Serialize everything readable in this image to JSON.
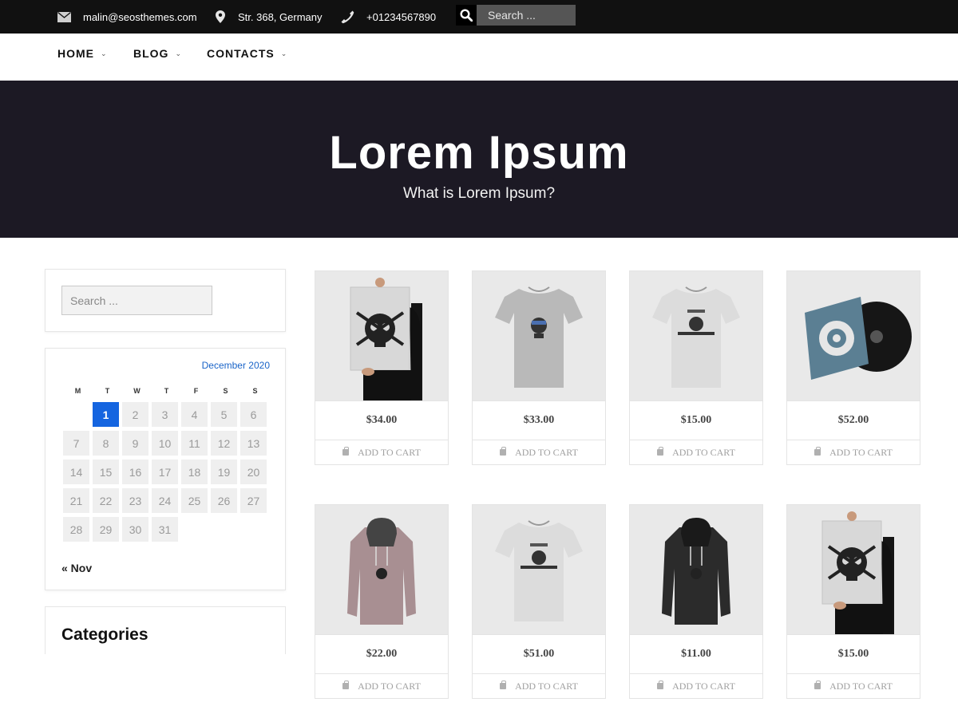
{
  "topbar": {
    "email": "malin@seosthemes.com",
    "address": "Str. 368, Germany",
    "phone": "+01234567890",
    "search_placeholder": "Search ..."
  },
  "nav": {
    "items": [
      {
        "label": "HOME"
      },
      {
        "label": "BLOG"
      },
      {
        "label": "CONTACTS"
      }
    ]
  },
  "hero": {
    "title": "Lorem Ipsum",
    "subtitle": "What is Lorem Ipsum?"
  },
  "sidebar": {
    "search_placeholder": "Search ...",
    "calendar": {
      "caption": "December 2020",
      "weekdays": [
        "M",
        "T",
        "W",
        "T",
        "F",
        "S",
        "S"
      ],
      "rows": [
        [
          "",
          "1",
          "2",
          "3",
          "4",
          "5",
          "6"
        ],
        [
          "7",
          "8",
          "9",
          "10",
          "11",
          "12",
          "13"
        ],
        [
          "14",
          "15",
          "16",
          "17",
          "18",
          "19",
          "20"
        ],
        [
          "21",
          "22",
          "23",
          "24",
          "25",
          "26",
          "27"
        ],
        [
          "28",
          "29",
          "30",
          "31",
          "",
          "",
          ""
        ]
      ],
      "today": "1",
      "prev_link": "« Nov"
    },
    "categories_title": "Categories"
  },
  "products": [
    {
      "price": "$34.00",
      "cart_label": "ADD TO CART",
      "image": "poster-skull"
    },
    {
      "price": "$33.00",
      "cart_label": "ADD TO CART",
      "image": "tshirt-ninja"
    },
    {
      "price": "$15.00",
      "cart_label": "ADD TO CART",
      "image": "tshirt-woo"
    },
    {
      "price": "$52.00",
      "cart_label": "ADD TO CART",
      "image": "vinyl-album"
    },
    {
      "price": "$22.00",
      "cart_label": "ADD TO CART",
      "image": "hoodie-pink"
    },
    {
      "price": "$51.00",
      "cart_label": "ADD TO CART",
      "image": "tshirt-woo"
    },
    {
      "price": "$11.00",
      "cart_label": "ADD TO CART",
      "image": "hoodie-black"
    },
    {
      "price": "$15.00",
      "cart_label": "ADD TO CART",
      "image": "poster-skull"
    }
  ],
  "colors": {
    "topbar_bg": "#111111",
    "hero_bg": "#1c1924",
    "accent_blue": "#1565e0"
  }
}
